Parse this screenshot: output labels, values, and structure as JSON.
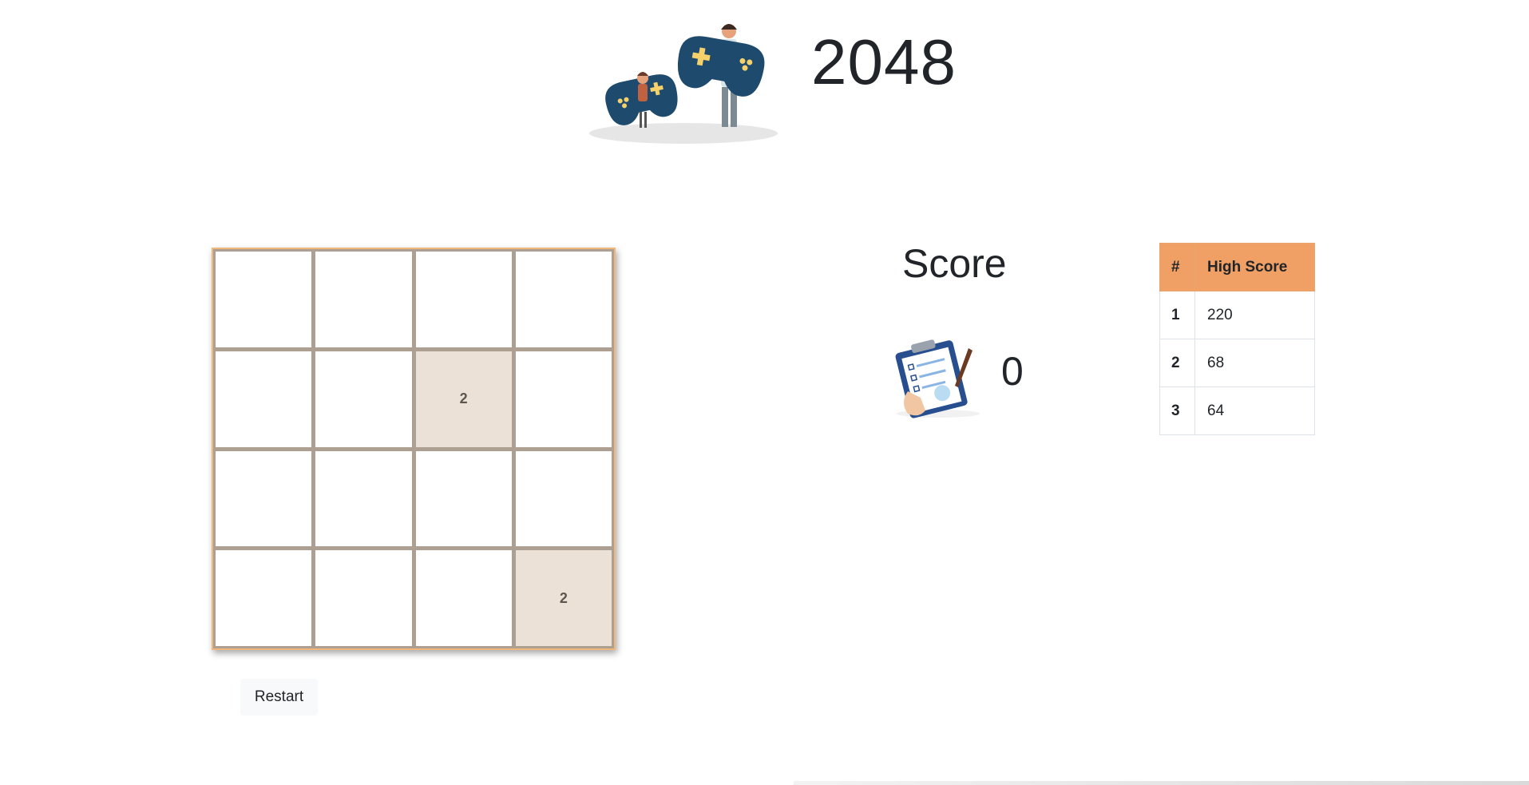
{
  "header": {
    "title": "2048",
    "illustration": "gamers-with-controllers-illustration"
  },
  "board": {
    "size": 4,
    "cells": [
      [
        null,
        null,
        null,
        null
      ],
      [
        null,
        null,
        2,
        null
      ],
      [
        null,
        null,
        null,
        null
      ],
      [
        null,
        null,
        null,
        2
      ]
    ]
  },
  "controls": {
    "restart_label": "Restart"
  },
  "score": {
    "label": "Score",
    "value": "0",
    "icon": "clipboard-icon"
  },
  "high_scores": {
    "headers": [
      "#",
      "High Score"
    ],
    "rows": [
      {
        "rank": "1",
        "score": "220"
      },
      {
        "rank": "2",
        "score": "68"
      },
      {
        "rank": "3",
        "score": "64"
      }
    ]
  },
  "colors": {
    "board_border": "#f0b77a",
    "grid_lines": "#ada093",
    "tile_2": "#ebe1d6",
    "table_header": "#f0a064"
  }
}
